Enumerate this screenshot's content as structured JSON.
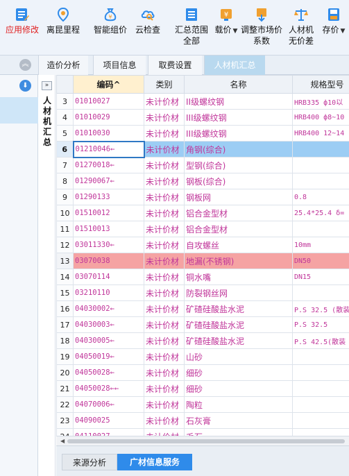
{
  "ribbon": {
    "tools": [
      {
        "id": "app-modify",
        "label": "应用修改",
        "icon": "pencil-list-icon"
      },
      {
        "id": "distance",
        "label": "离昆里程",
        "icon": "map-pin-icon"
      },
      {
        "id": "smart-price",
        "label": "智能组价",
        "icon": "money-bag-icon"
      },
      {
        "id": "cloud-check",
        "label": "云检查",
        "icon": "cloud-search-icon"
      },
      {
        "id": "summary-scope",
        "label": "汇总范围\n全部",
        "icon": "summary-list-icon"
      },
      {
        "id": "lock-price",
        "label": "载价",
        "icon": "price-tag-icon"
      },
      {
        "id": "adjust-market",
        "label": "调整市场价\n系数",
        "icon": "adjust-price-icon"
      },
      {
        "id": "no-price-diff",
        "label": "人材机\n无价差",
        "icon": "balance-scale-icon"
      },
      {
        "id": "save-price",
        "label": "存价",
        "icon": "save-price-icon"
      }
    ]
  },
  "tabs": [
    "造价分析",
    "项目信息",
    "取费设置",
    "人材机汇总"
  ],
  "active_tab": "人材机汇总",
  "side_tab_label": "人材机汇总",
  "table": {
    "headers": [
      "",
      "编码",
      "类别",
      "名称",
      "规格型号"
    ],
    "sort_indicator": "^",
    "rows": [
      {
        "num": "3",
        "code": "01010027",
        "category": "未计价材",
        "name": "II级螺纹钢",
        "spec": "HRB335 ф10以"
      },
      {
        "num": "4",
        "code": "01010029",
        "category": "未计价材",
        "name": "III级螺纹钢",
        "spec": "HRB400 ф8~10"
      },
      {
        "num": "5",
        "code": "01010030",
        "category": "未计价材",
        "name": "III级螺纹钢",
        "spec": "HRB400 12~14"
      },
      {
        "num": "6",
        "code": "01210046←",
        "category": "未计价材",
        "name": "角钢(综合)",
        "spec": ""
      },
      {
        "num": "7",
        "code": "01270018←",
        "category": "未计价材",
        "name": "型钢(综合)",
        "spec": ""
      },
      {
        "num": "8",
        "code": "01290067←",
        "category": "未计价材",
        "name": "钢板(综合)",
        "spec": ""
      },
      {
        "num": "9",
        "code": "01290133",
        "category": "未计价材",
        "name": "钢板网",
        "spec": "0.8"
      },
      {
        "num": "10",
        "code": "01510012",
        "category": "未计价材",
        "name": "铝合金型材",
        "spec": "25.4*25.4 δ="
      },
      {
        "num": "11",
        "code": "01510013",
        "category": "未计价材",
        "name": "铝合金型材",
        "spec": ""
      },
      {
        "num": "12",
        "code": "03011330←",
        "category": "未计价材",
        "name": "自攻螺丝",
        "spec": "10mm"
      },
      {
        "num": "13",
        "code": "03070038",
        "category": "未计价材",
        "name": "地漏(不锈钢)",
        "spec": "DN50"
      },
      {
        "num": "14",
        "code": "03070114",
        "category": "未计价材",
        "name": "铜水嘴",
        "spec": "DN15"
      },
      {
        "num": "15",
        "code": "03210110",
        "category": "未计价材",
        "name": "防裂钢丝网",
        "spec": ""
      },
      {
        "num": "16",
        "code": "04030002←",
        "category": "未计价材",
        "name": "矿碴硅酸盐水泥",
        "spec": "P.S 32.5 (散装"
      },
      {
        "num": "17",
        "code": "04030003←",
        "category": "未计价材",
        "name": "矿碴硅酸盐水泥",
        "spec": "P.S 32.5"
      },
      {
        "num": "18",
        "code": "04030005←",
        "category": "未计价材",
        "name": "矿碴硅酸盐水泥",
        "spec": "P.S 42.5(散装"
      },
      {
        "num": "19",
        "code": "04050019←",
        "category": "未计价材",
        "name": "山砂",
        "spec": ""
      },
      {
        "num": "20",
        "code": "04050028←",
        "category": "未计价材",
        "name": "细砂",
        "spec": ""
      },
      {
        "num": "21",
        "code": "04050028←←",
        "category": "未计价材",
        "name": "细砂",
        "spec": ""
      },
      {
        "num": "22",
        "code": "04070006←",
        "category": "未计价材",
        "name": "陶粒",
        "spec": ""
      },
      {
        "num": "23",
        "code": "04090025",
        "category": "未计价材",
        "name": "石灰膏",
        "spec": ""
      },
      {
        "num": "24",
        "code": "04110027",
        "category": "未计价材",
        "name": "毛石",
        "spec": ""
      }
    ],
    "selected_row": "6",
    "highlighted_row": "13"
  },
  "bottom_tabs": [
    "来源分析",
    "广材信息服务"
  ],
  "active_bottom_tab": "广材信息服务",
  "colors": {
    "accent": "#2f8bea",
    "text_pink": "#c0359a",
    "selected_row": "#9ccdf4",
    "highlight_row": "#f5a3a3",
    "active_tab": "#b9d9ef"
  }
}
